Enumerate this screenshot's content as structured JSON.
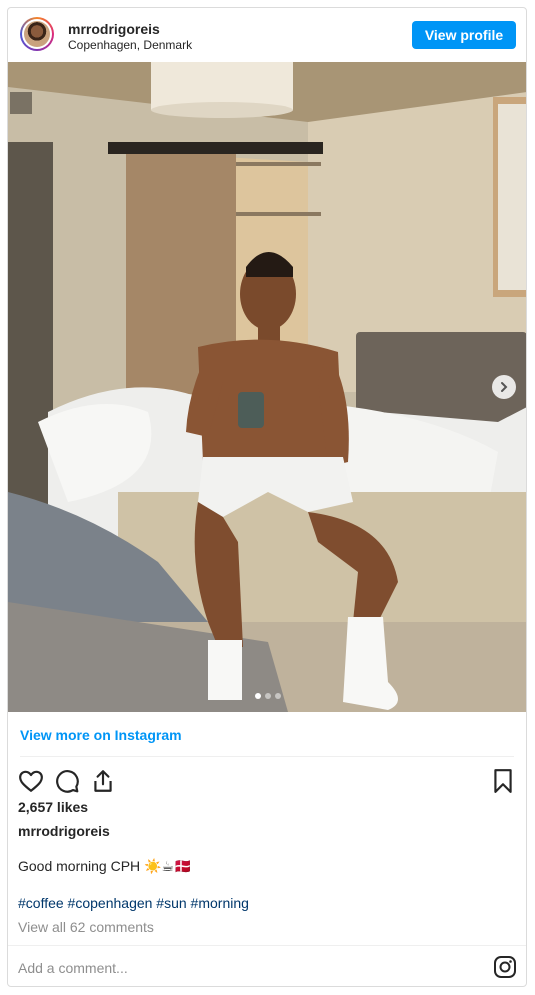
{
  "header": {
    "username": "mrrodrigoreis",
    "location": "Copenhagen, Denmark",
    "view_profile_label": "View profile"
  },
  "post": {
    "view_more_label": "View more on Instagram",
    "likes": "2,657 likes",
    "caption_user": "mrrodrigoreis",
    "caption_text": "Good morning CPH ☀️☕🇩🇰",
    "hashtags": "#coffee #copenhagen #sun #morning",
    "view_comments": "View all 62 comments",
    "add_comment_placeholder": "Add a comment...",
    "carousel_dots": 3,
    "carousel_active": 0
  },
  "colors": {
    "accent": "#0095f6",
    "hashtag": "#00376b",
    "muted": "#8e8e8e",
    "border": "#dbdbdb"
  },
  "icons": [
    "heart-icon",
    "comment-icon",
    "share-icon",
    "bookmark-icon",
    "chevron-right-icon",
    "instagram-logo-icon"
  ]
}
